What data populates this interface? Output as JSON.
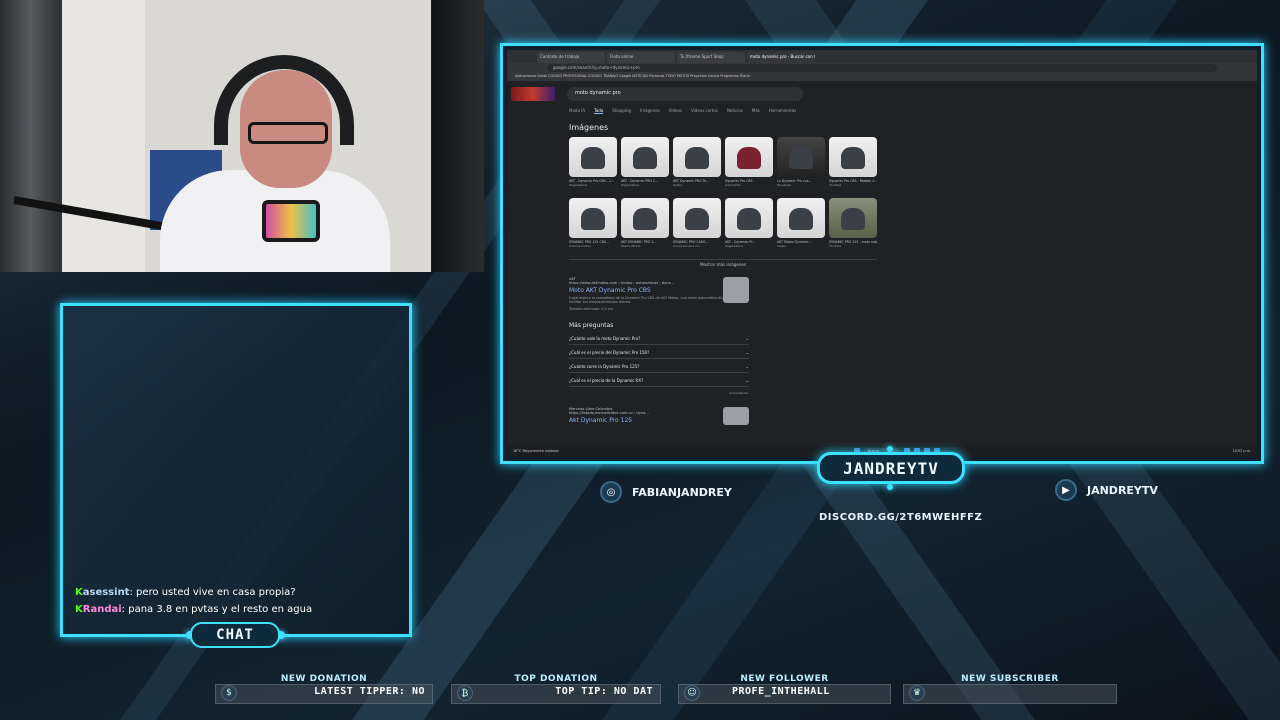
{
  "browser": {
    "tabs": [
      {
        "label": "Contrato de trabajo"
      },
      {
        "label": "Flota online"
      },
      {
        "label": "Tu Xtreme Sport Shop"
      },
      {
        "label": "moto dynamic pro - Buscar con Google"
      }
    ],
    "url": "google.com/search?q=moto+dynamic+pro",
    "bookmarks": "Aplicaciones  Gmail  CODIGO PROFESIONAL  CODIGO TRABAJO  Google  NOTICIAS  Personas  TODO MOTOS  Proyectos  Cocina  Programas  Diario"
  },
  "google": {
    "query": "moto dynamic pro",
    "nav": [
      {
        "label": "Modo IA",
        "active": false
      },
      {
        "label": "Todo",
        "active": true
      },
      {
        "label": "Shopping",
        "active": false
      },
      {
        "label": "Imágenes",
        "active": false
      },
      {
        "label": "Videos",
        "active": false
      },
      {
        "label": "Videos cortos",
        "active": false
      },
      {
        "label": "Noticias",
        "active": false
      },
      {
        "label": "Más",
        "active": false
      },
      {
        "label": "Herramientas",
        "active": false
      }
    ],
    "images_title": "Imágenes",
    "images_row1": [
      {
        "caption": "AKT - Dynamic Pro CBS - 2...",
        "source": "Zagarestore",
        "style": "light"
      },
      {
        "caption": "AKT - Dynamic PRO C...",
        "source": "Zagarestore",
        "style": "light"
      },
      {
        "caption": "AKT Dynamic PRO Te...",
        "source": "Kalipo",
        "style": "light"
      },
      {
        "caption": "Dynamic Pro CBS",
        "source": "Autometro",
        "style": "red"
      },
      {
        "caption": "La Dynamic Pro cua...",
        "source": "Facebook",
        "style": "dark"
      },
      {
        "caption": "Dynamic Pro CBS - Modelo 2...",
        "source": "YouTube",
        "style": "light"
      }
    ],
    "images_row2": [
      {
        "caption": "DYNAMIC PRO 125 CBS...",
        "source": "Cobone motos",
        "style": "light"
      },
      {
        "caption": "AKT DYNAMIC PRO 1...",
        "source": "Oferta Motos",
        "style": "light"
      },
      {
        "caption": "DYNAMIC PRO CARG...",
        "source": "Concesionaria mo...",
        "style": "light"
      },
      {
        "caption": "AKT - Dynamic Pr...",
        "source": "Zagarestore",
        "style": "light"
      },
      {
        "caption": "AKT Motos Dynamic...",
        "source": "Kalipo",
        "style": "light"
      },
      {
        "caption": "DYNAMIC PRO 125 - moto automá...",
        "source": "YouTube",
        "style": "street"
      }
    ],
    "more_images": "Mostrar más imágenes",
    "result1": {
      "site": "AKT",
      "url": "https://www.aktmotos.com › motos › automaticas › dyna...",
      "title": "Moto AKT Dynamic Pro CBS",
      "desc": "Experimenta la comodidad de la Dynamic Pro CBS de AKT Motos, una moto automática diseñada para facilitar tus desplazamientos diarios.",
      "extra": "Tamaño estimado: 0,3 cm"
    },
    "paa_title": "Más preguntas",
    "paa": [
      {
        "q": "¿Cuánto vale la moto Dynamic Pro?"
      },
      {
        "q": "¿Cuál es el precio del Dynamic Pro 150?"
      },
      {
        "q": "¿Cuánto corre la Dynamic Pro 125?"
      },
      {
        "q": "¿Cuál es el precio de la Dynamic RX?"
      }
    ],
    "comments": "Comentarios",
    "result2": {
      "site": "Mercado Libre Colombia",
      "url": "https://listado.mercadolibre.com.co › dyna...",
      "title": "Akt Dynamic Pro 125"
    }
  },
  "taskbar": {
    "weather": "18°C Mayormente nublado",
    "search": "Buscar",
    "clock": "10:52 p.m."
  },
  "overlay": {
    "channel_name": "JANDREYTV",
    "instagram": "FABIANJANDREY",
    "youtube": "JANDREYTV",
    "discord": "DISCORD.GG/2T6MWEHFFZ",
    "chat_label": "CHAT"
  },
  "chat": [
    {
      "user": "asessint",
      "message": "pero usted vive en casa propia?",
      "color": "#b9d8f5"
    },
    {
      "user": "Randai",
      "message": "pana 3.8 en pvtas y el resto en agua",
      "color": "#ff8ad8"
    }
  ],
  "stats": [
    {
      "label": "NEW DONATION",
      "value": "LATEST TIPPER: NO",
      "icon": "donation-icon"
    },
    {
      "label": "TOP DONATION",
      "value": "TOP TIP: NO DAT",
      "icon": "money-bag-icon"
    },
    {
      "label": "NEW FOLLOWER",
      "value": "PROFE_INTHEHALL",
      "icon": "follower-icon"
    },
    {
      "label": "NEW SUBSCRIBER",
      "value": "",
      "icon": "crown-icon"
    }
  ],
  "colors": {
    "accent": "#3ee0ff",
    "kick_green": "#53fc18",
    "link": "#8ab4f8"
  }
}
